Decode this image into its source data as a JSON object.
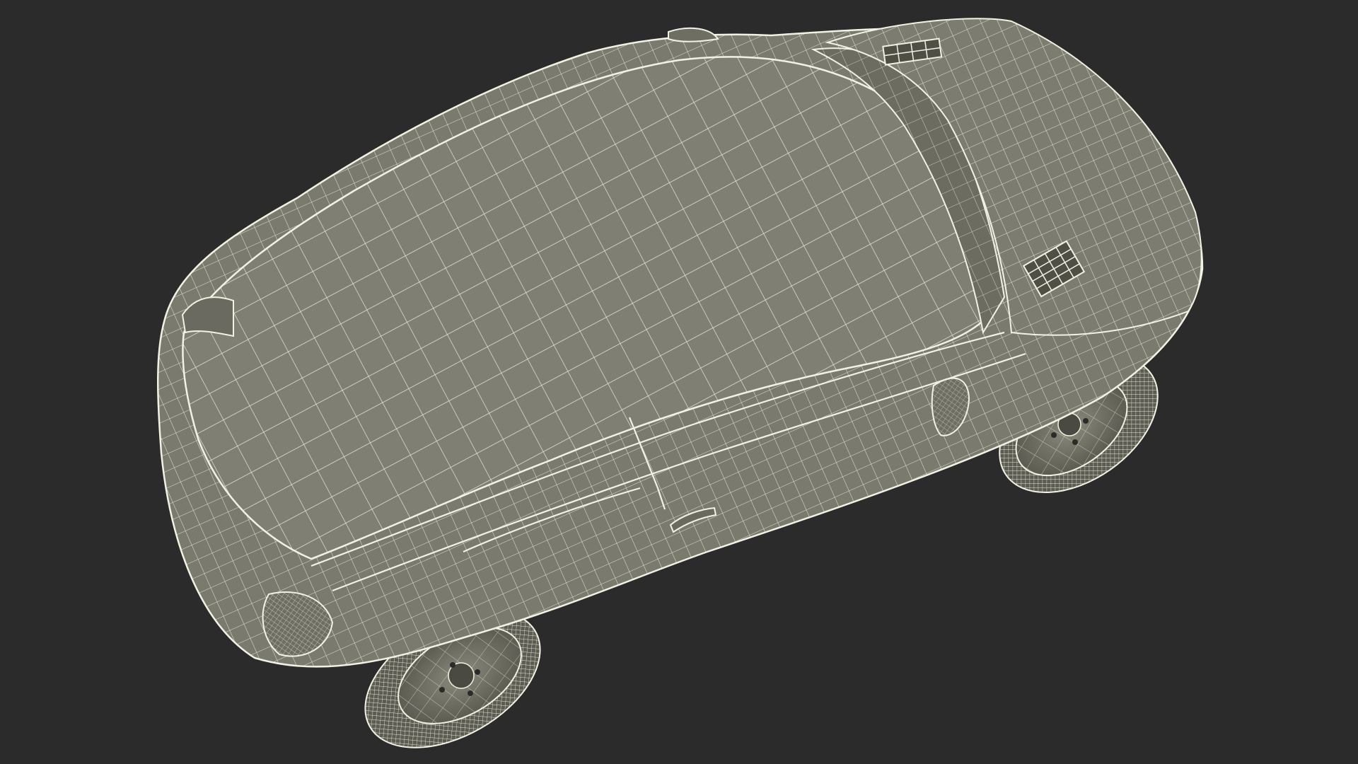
{
  "scene": {
    "subject": "car-wireframe-render",
    "background_color": "#2b2b2b",
    "surface_color": "#7d7d70",
    "surface_dark": "#5f5f55",
    "wire_color": "#f2f2e4",
    "tire_color": "#6e6e63"
  }
}
